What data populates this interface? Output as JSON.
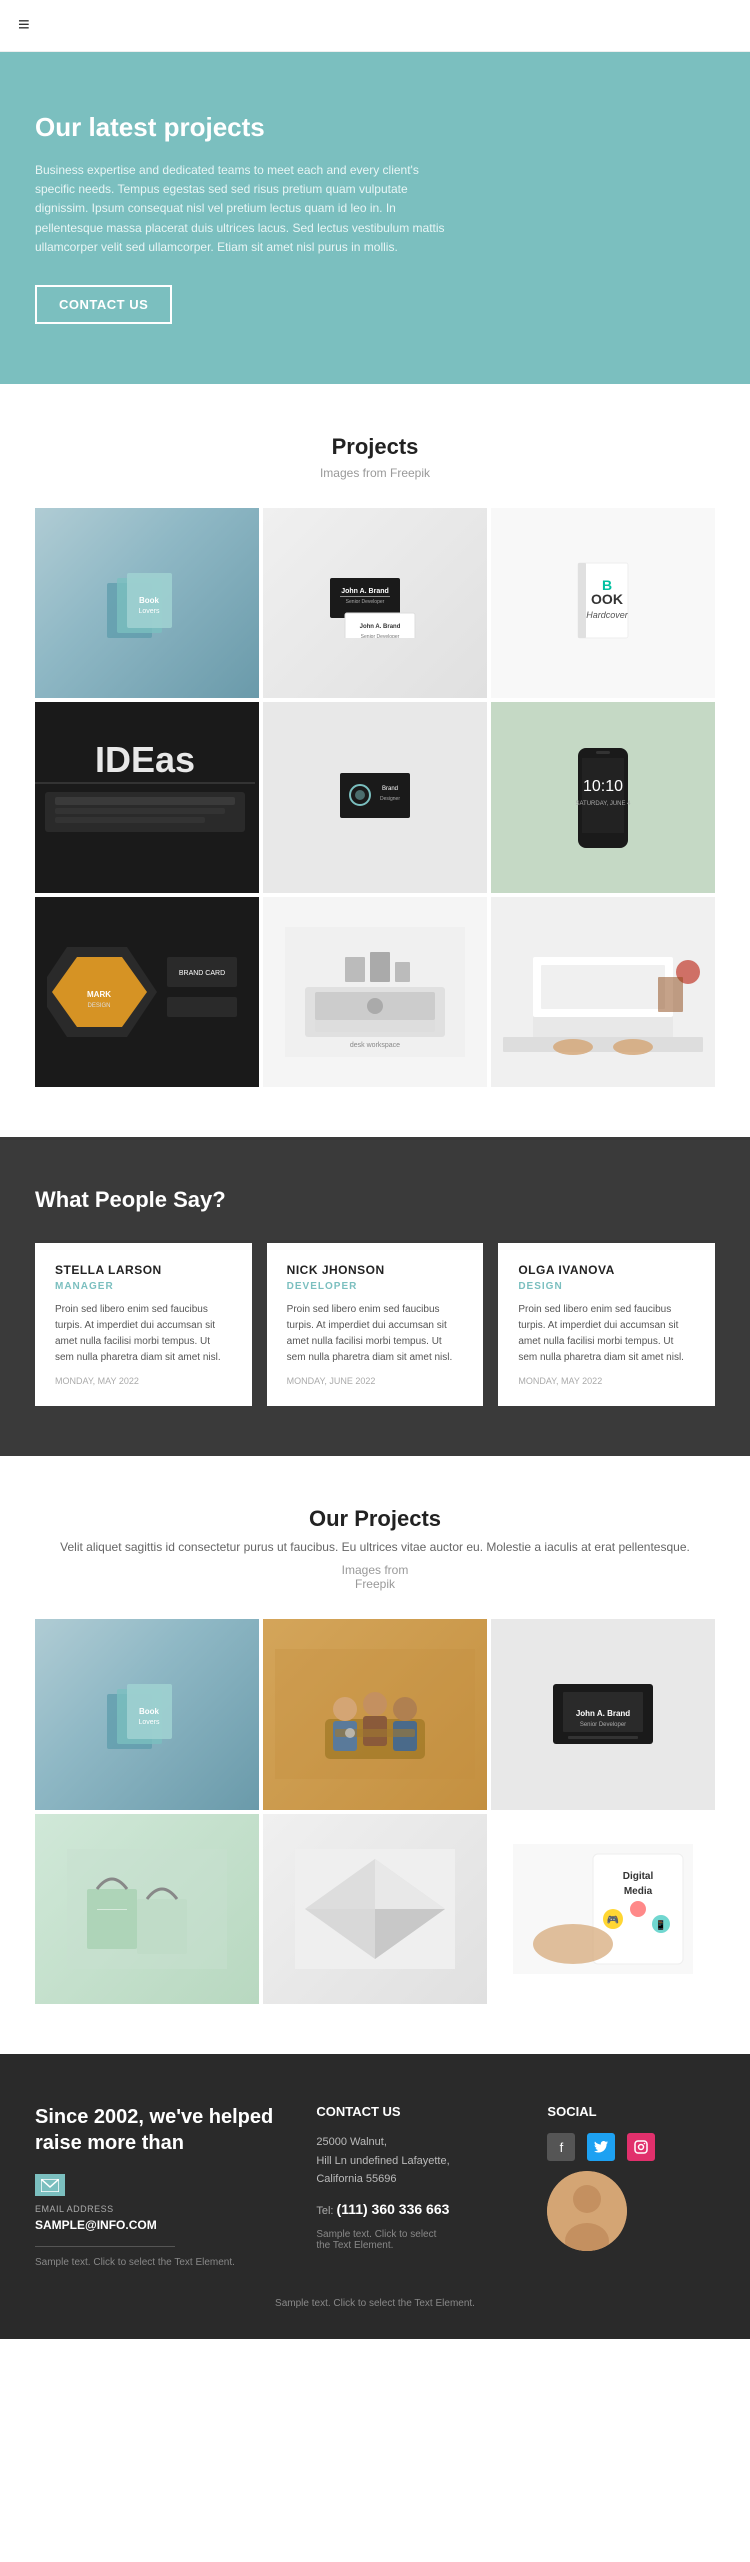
{
  "nav": {
    "hamburger_icon": "≡"
  },
  "hero": {
    "title": "Our latest projects",
    "description": "Business expertise and dedicated teams to meet each and every client's specific needs. Tempus egestas sed sed risus pretium quam vulputate dignissim. Ipsum consequat nisl vel pretium lectus quam id leo in. In pellentesque massa placerat duis ultrices lacus. Sed lectus vestibulum mattis ullamcorper velit sed ullamcorper. Etiam sit amet nisl purus in mollis.",
    "button_label": "CONTACT US"
  },
  "projects_section": {
    "title": "Projects",
    "subtitle": "Images from Freepik",
    "grid_images": [
      {
        "alt": "Books stack teal",
        "style": "books"
      },
      {
        "alt": "Business card black white",
        "style": "business-card-1"
      },
      {
        "alt": "Book Hardcover",
        "style": "book-hardcover"
      },
      {
        "alt": "IDEAS laptop",
        "style": "ideas"
      },
      {
        "alt": "Business card minimal",
        "style": "business-card-2"
      },
      {
        "alt": "Phone mockup",
        "style": "phone"
      },
      {
        "alt": "Design card dark",
        "style": "design-card"
      },
      {
        "alt": "Workspace desk",
        "style": "workspace"
      },
      {
        "alt": "Laptop typing overhead",
        "style": "laptop-typing"
      }
    ]
  },
  "testimonials": {
    "section_title": "What People Say?",
    "items": [
      {
        "name": "STELLA LARSON",
        "role": "MANAGER",
        "text": "Proin sed libero enim sed faucibus turpis. At imperdiet dui accumsan sit amet nulla facilisi morbi tempus. Ut sem nulla pharetra diam sit amet nisl.",
        "date": "MONDAY, MAY 2022"
      },
      {
        "name": "NICK JHONSON",
        "role": "DEVELOPER",
        "text": "Proin sed libero enim sed faucibus turpis. At imperdiet dui accumsan sit amet nulla facilisi morbi tempus. Ut sem nulla pharetra diam sit amet nisl.",
        "date": "MONDAY, JUNE 2022"
      },
      {
        "name": "OLGA IVANOVA",
        "role": "DESIGN",
        "text": "Proin sed libero enim sed faucibus turpis. At imperdiet dui accumsan sit amet nulla facilisi morbi tempus. Ut sem nulla pharetra diam sit amet nisl.",
        "date": "MONDAY, MAY 2022"
      }
    ]
  },
  "our_projects": {
    "title": "Our Projects",
    "description": "Velit aliquet sagittis id consectetur purus ut faucibus. Eu ultrices vitae auctor eu. Molestie a iaculis at erat pellentesque.",
    "images_from": "Images from\nFreepik",
    "grid_images": [
      {
        "alt": "Books stack teal",
        "style": "books"
      },
      {
        "alt": "Team meeting",
        "style": "team-meeting"
      },
      {
        "alt": "Business card dark",
        "style": "biz-card-dark"
      },
      {
        "alt": "Shopping bags mint",
        "style": "shopping-bags"
      },
      {
        "alt": "Paper folded",
        "style": "paper-folded"
      },
      {
        "alt": "Digital media",
        "style": "digital-media"
      }
    ]
  },
  "footer": {
    "tagline": "Since 2002, we've helped raise more than",
    "email_label": "EMAIL ADDRESS",
    "email": "SAMPLE@INFO.COM",
    "sample_text": "Sample text. Click to select the Text Element.",
    "contact_us_title": "CONTACT US",
    "address": "25000 Walnut,\nHill Ln undefined Lafayette,\nCalifornia 55696",
    "tel_label": "Tel:",
    "tel": "(111) 360 336 663",
    "contact_sample_text": "Sample text. Click to select\nthe Text Element.",
    "social_title": "SOCIAL",
    "social_icons": [
      "f",
      "t",
      "in"
    ],
    "bottom_sample": "Sample text. Click to select the Text Element."
  }
}
